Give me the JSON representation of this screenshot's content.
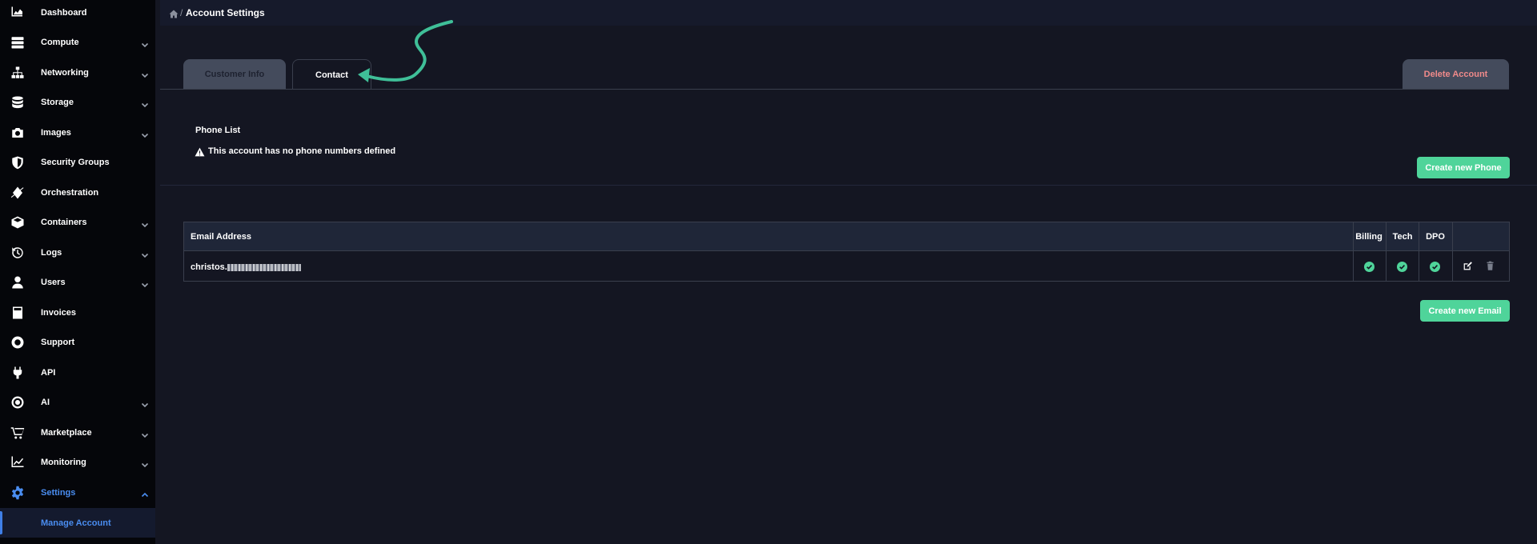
{
  "sidebar": {
    "items": [
      {
        "label": "Dashboard",
        "icon": "chart-area-icon",
        "expandable": false
      },
      {
        "label": "Compute",
        "icon": "server-icon",
        "expandable": true
      },
      {
        "label": "Networking",
        "icon": "network-icon",
        "expandable": true
      },
      {
        "label": "Storage",
        "icon": "database-icon",
        "expandable": true
      },
      {
        "label": "Images",
        "icon": "camera-icon",
        "expandable": true
      },
      {
        "label": "Security Groups",
        "icon": "shield-icon",
        "expandable": false
      },
      {
        "label": "Orchestration",
        "icon": "layers-icon",
        "expandable": false
      },
      {
        "label": "Containers",
        "icon": "cube-icon",
        "expandable": true
      },
      {
        "label": "Logs",
        "icon": "history-icon",
        "expandable": true
      },
      {
        "label": "Users",
        "icon": "user-icon",
        "expandable": true
      },
      {
        "label": "Invoices",
        "icon": "calculator-icon",
        "expandable": false
      },
      {
        "label": "Support",
        "icon": "life-ring-icon",
        "expandable": false
      },
      {
        "label": "API",
        "icon": "plug-icon",
        "expandable": false
      },
      {
        "label": "AI",
        "icon": "ai-icon",
        "expandable": true
      },
      {
        "label": "Marketplace",
        "icon": "cart-icon",
        "expandable": true
      },
      {
        "label": "Monitoring",
        "icon": "chart-line-icon",
        "expandable": true
      },
      {
        "label": "Settings",
        "icon": "gear-icon",
        "expandable": true,
        "active": true
      }
    ],
    "sub_item": {
      "label": "Manage Account"
    },
    "active_color": "#4a8df0"
  },
  "breadcrumb": {
    "separator": "/",
    "title": "Account Settings"
  },
  "tabs": {
    "customer_info": "Customer Info",
    "contact": "Contact",
    "delete_account": "Delete Account"
  },
  "phone": {
    "title": "Phone List",
    "empty_message": "This account has no phone numbers defined",
    "create_button": "Create new Phone"
  },
  "email": {
    "headers": {
      "email": "Email Address",
      "billing": "Billing",
      "tech": "Tech",
      "dpo": "DPO"
    },
    "rows": [
      {
        "email_prefix": "christos.",
        "billing": true,
        "tech": true,
        "dpo": true
      }
    ],
    "create_button": "Create new Email"
  },
  "colors": {
    "accent_green": "#4fd49a",
    "delete_text": "#f08a8a",
    "annotation": "#3fbf98"
  }
}
